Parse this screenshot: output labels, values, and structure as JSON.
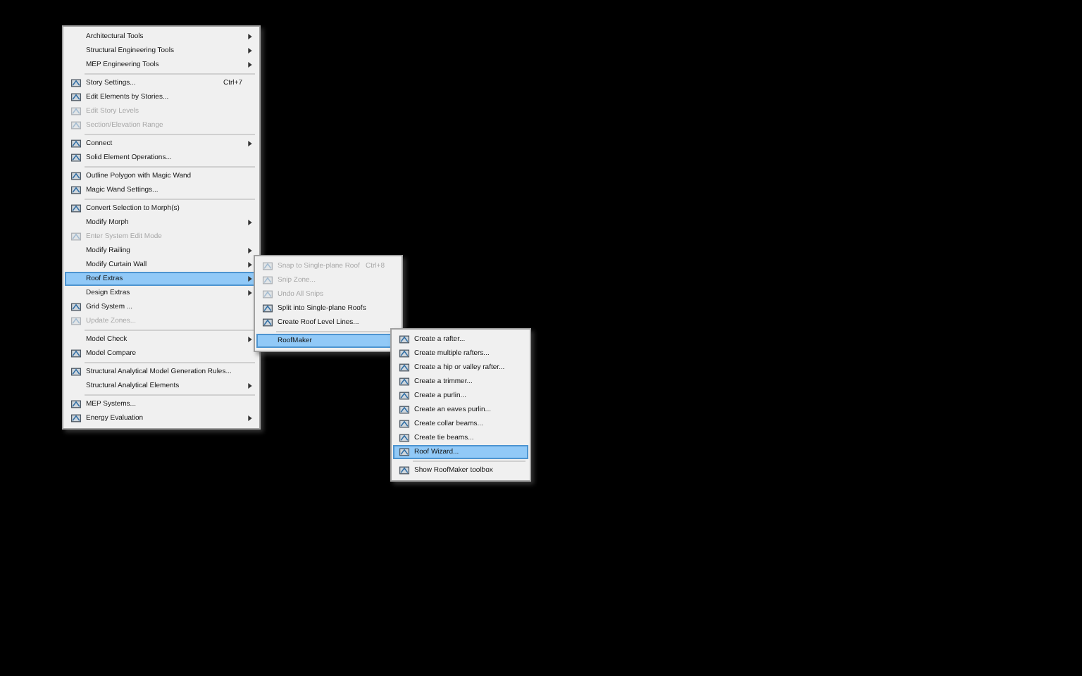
{
  "menus": [
    {
      "items": [
        {
          "kind": "item",
          "label": "Architectural Tools",
          "submenu": true,
          "disabled": false,
          "selected": false,
          "icon": false
        },
        {
          "kind": "item",
          "label": "Structural Engineering Tools",
          "submenu": true,
          "disabled": false,
          "selected": false,
          "icon": false
        },
        {
          "kind": "item",
          "label": "MEP Engineering Tools",
          "submenu": true,
          "disabled": false,
          "selected": false,
          "icon": false
        },
        {
          "kind": "separator"
        },
        {
          "kind": "item",
          "label": "Story Settings...",
          "shortcut": "Ctrl+7",
          "submenu": false,
          "disabled": false,
          "selected": false,
          "icon": true
        },
        {
          "kind": "item",
          "label": "Edit Elements by Stories...",
          "submenu": false,
          "disabled": false,
          "selected": false,
          "icon": true
        },
        {
          "kind": "item",
          "label": "Edit Story Levels",
          "submenu": false,
          "disabled": true,
          "selected": false,
          "icon": true
        },
        {
          "kind": "item",
          "label": "Section/Elevation Range",
          "submenu": false,
          "disabled": true,
          "selected": false,
          "icon": true
        },
        {
          "kind": "separator"
        },
        {
          "kind": "item",
          "label": "Connect",
          "submenu": true,
          "disabled": false,
          "selected": false,
          "icon": true
        },
        {
          "kind": "item",
          "label": "Solid Element Operations...",
          "submenu": false,
          "disabled": false,
          "selected": false,
          "icon": true
        },
        {
          "kind": "separator"
        },
        {
          "kind": "item",
          "label": "Outline Polygon with Magic Wand",
          "submenu": false,
          "disabled": false,
          "selected": false,
          "icon": true
        },
        {
          "kind": "item",
          "label": "Magic Wand Settings...",
          "submenu": false,
          "disabled": false,
          "selected": false,
          "icon": true
        },
        {
          "kind": "separator"
        },
        {
          "kind": "item",
          "label": "Convert Selection to Morph(s)",
          "submenu": false,
          "disabled": false,
          "selected": false,
          "icon": true
        },
        {
          "kind": "item",
          "label": "Modify Morph",
          "submenu": true,
          "disabled": false,
          "selected": false,
          "icon": false
        },
        {
          "kind": "item",
          "label": "Enter System Edit Mode",
          "submenu": false,
          "disabled": true,
          "selected": false,
          "icon": true
        },
        {
          "kind": "item",
          "label": "Modify Railing",
          "submenu": true,
          "disabled": false,
          "selected": false,
          "icon": false
        },
        {
          "kind": "item",
          "label": "Modify Curtain Wall",
          "submenu": true,
          "disabled": false,
          "selected": false,
          "icon": false
        },
        {
          "kind": "item",
          "label": "Roof Extras",
          "submenu": true,
          "disabled": false,
          "selected": true,
          "icon": false
        },
        {
          "kind": "item",
          "label": "Design Extras",
          "submenu": true,
          "disabled": false,
          "selected": false,
          "icon": false
        },
        {
          "kind": "item",
          "label": "Grid System ...",
          "submenu": false,
          "disabled": false,
          "selected": false,
          "icon": true
        },
        {
          "kind": "item",
          "label": "Update Zones...",
          "submenu": false,
          "disabled": true,
          "selected": false,
          "icon": true
        },
        {
          "kind": "separator"
        },
        {
          "kind": "item",
          "label": "Model Check",
          "submenu": true,
          "disabled": false,
          "selected": false,
          "icon": false
        },
        {
          "kind": "item",
          "label": "Model Compare",
          "submenu": false,
          "disabled": false,
          "selected": false,
          "icon": true
        },
        {
          "kind": "separator"
        },
        {
          "kind": "item",
          "label": "Structural Analytical Model Generation Rules...",
          "submenu": false,
          "disabled": false,
          "selected": false,
          "icon": true
        },
        {
          "kind": "item",
          "label": "Structural Analytical Elements",
          "submenu": true,
          "disabled": false,
          "selected": false,
          "icon": false
        },
        {
          "kind": "separator"
        },
        {
          "kind": "item",
          "label": "MEP Systems...",
          "submenu": false,
          "disabled": false,
          "selected": false,
          "icon": true
        },
        {
          "kind": "item",
          "label": "Energy Evaluation",
          "submenu": true,
          "disabled": false,
          "selected": false,
          "icon": true
        }
      ]
    },
    {
      "items": [
        {
          "kind": "item",
          "label": "Snap to Single-plane Roof",
          "shortcut": "Ctrl+8",
          "submenu": false,
          "disabled": true,
          "selected": false,
          "icon": true
        },
        {
          "kind": "item",
          "label": "Snip Zone...",
          "submenu": false,
          "disabled": true,
          "selected": false,
          "icon": true
        },
        {
          "kind": "item",
          "label": "Undo All Snips",
          "submenu": false,
          "disabled": true,
          "selected": false,
          "icon": true
        },
        {
          "kind": "item",
          "label": "Split into Single-plane Roofs",
          "submenu": false,
          "disabled": false,
          "selected": false,
          "icon": true
        },
        {
          "kind": "item",
          "label": "Create Roof Level Lines...",
          "submenu": false,
          "disabled": false,
          "selected": false,
          "icon": true
        },
        {
          "kind": "separator"
        },
        {
          "kind": "item",
          "label": "RoofMaker",
          "submenu": true,
          "disabled": false,
          "selected": true,
          "icon": false
        }
      ]
    },
    {
      "items": [
        {
          "kind": "item",
          "label": "Create a rafter...",
          "submenu": false,
          "disabled": false,
          "selected": false,
          "icon": true
        },
        {
          "kind": "item",
          "label": "Create multiple rafters...",
          "submenu": false,
          "disabled": false,
          "selected": false,
          "icon": true
        },
        {
          "kind": "item",
          "label": "Create a hip or valley rafter...",
          "submenu": false,
          "disabled": false,
          "selected": false,
          "icon": true
        },
        {
          "kind": "item",
          "label": "Create a trimmer...",
          "submenu": false,
          "disabled": false,
          "selected": false,
          "icon": true
        },
        {
          "kind": "item",
          "label": "Create a purlin...",
          "submenu": false,
          "disabled": false,
          "selected": false,
          "icon": true
        },
        {
          "kind": "item",
          "label": "Create an eaves purlin...",
          "submenu": false,
          "disabled": false,
          "selected": false,
          "icon": true
        },
        {
          "kind": "item",
          "label": "Create collar beams...",
          "submenu": false,
          "disabled": false,
          "selected": false,
          "icon": true
        },
        {
          "kind": "item",
          "label": "Create tie beams...",
          "submenu": false,
          "disabled": false,
          "selected": false,
          "icon": true
        },
        {
          "kind": "item",
          "label": "Roof Wizard...",
          "submenu": false,
          "disabled": false,
          "selected": true,
          "icon": true
        },
        {
          "kind": "separator"
        },
        {
          "kind": "item",
          "label": "Show RoofMaker toolbox",
          "submenu": false,
          "disabled": false,
          "selected": false,
          "icon": true
        }
      ]
    }
  ]
}
